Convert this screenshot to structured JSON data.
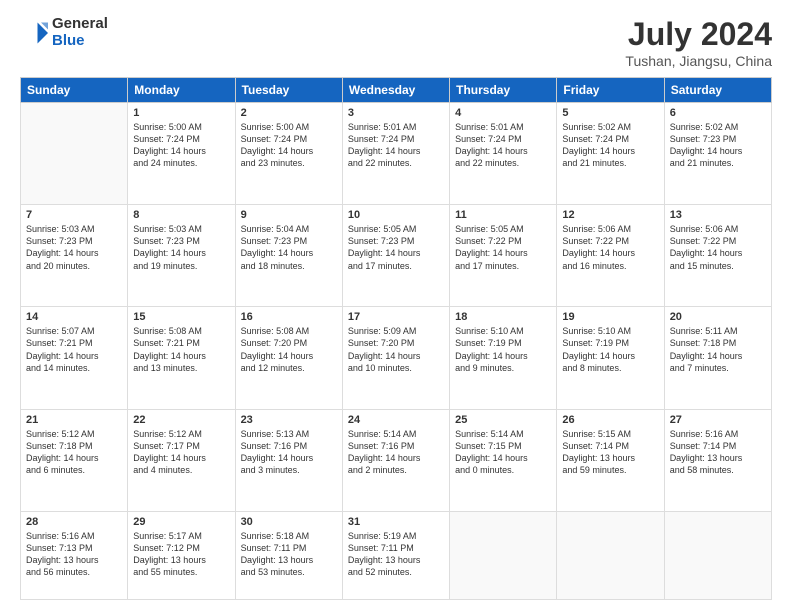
{
  "header": {
    "logo_general": "General",
    "logo_blue": "Blue",
    "month_year": "July 2024",
    "location": "Tushan, Jiangsu, China"
  },
  "days_of_week": [
    "Sunday",
    "Monday",
    "Tuesday",
    "Wednesday",
    "Thursday",
    "Friday",
    "Saturday"
  ],
  "weeks": [
    [
      {
        "day": "",
        "content": ""
      },
      {
        "day": "1",
        "content": "Sunrise: 5:00 AM\nSunset: 7:24 PM\nDaylight: 14 hours\nand 24 minutes."
      },
      {
        "day": "2",
        "content": "Sunrise: 5:00 AM\nSunset: 7:24 PM\nDaylight: 14 hours\nand 23 minutes."
      },
      {
        "day": "3",
        "content": "Sunrise: 5:01 AM\nSunset: 7:24 PM\nDaylight: 14 hours\nand 22 minutes."
      },
      {
        "day": "4",
        "content": "Sunrise: 5:01 AM\nSunset: 7:24 PM\nDaylight: 14 hours\nand 22 minutes."
      },
      {
        "day": "5",
        "content": "Sunrise: 5:02 AM\nSunset: 7:24 PM\nDaylight: 14 hours\nand 21 minutes."
      },
      {
        "day": "6",
        "content": "Sunrise: 5:02 AM\nSunset: 7:23 PM\nDaylight: 14 hours\nand 21 minutes."
      }
    ],
    [
      {
        "day": "7",
        "content": "Sunrise: 5:03 AM\nSunset: 7:23 PM\nDaylight: 14 hours\nand 20 minutes."
      },
      {
        "day": "8",
        "content": "Sunrise: 5:03 AM\nSunset: 7:23 PM\nDaylight: 14 hours\nand 19 minutes."
      },
      {
        "day": "9",
        "content": "Sunrise: 5:04 AM\nSunset: 7:23 PM\nDaylight: 14 hours\nand 18 minutes."
      },
      {
        "day": "10",
        "content": "Sunrise: 5:05 AM\nSunset: 7:23 PM\nDaylight: 14 hours\nand 17 minutes."
      },
      {
        "day": "11",
        "content": "Sunrise: 5:05 AM\nSunset: 7:22 PM\nDaylight: 14 hours\nand 17 minutes."
      },
      {
        "day": "12",
        "content": "Sunrise: 5:06 AM\nSunset: 7:22 PM\nDaylight: 14 hours\nand 16 minutes."
      },
      {
        "day": "13",
        "content": "Sunrise: 5:06 AM\nSunset: 7:22 PM\nDaylight: 14 hours\nand 15 minutes."
      }
    ],
    [
      {
        "day": "14",
        "content": "Sunrise: 5:07 AM\nSunset: 7:21 PM\nDaylight: 14 hours\nand 14 minutes."
      },
      {
        "day": "15",
        "content": "Sunrise: 5:08 AM\nSunset: 7:21 PM\nDaylight: 14 hours\nand 13 minutes."
      },
      {
        "day": "16",
        "content": "Sunrise: 5:08 AM\nSunset: 7:20 PM\nDaylight: 14 hours\nand 12 minutes."
      },
      {
        "day": "17",
        "content": "Sunrise: 5:09 AM\nSunset: 7:20 PM\nDaylight: 14 hours\nand 10 minutes."
      },
      {
        "day": "18",
        "content": "Sunrise: 5:10 AM\nSunset: 7:19 PM\nDaylight: 14 hours\nand 9 minutes."
      },
      {
        "day": "19",
        "content": "Sunrise: 5:10 AM\nSunset: 7:19 PM\nDaylight: 14 hours\nand 8 minutes."
      },
      {
        "day": "20",
        "content": "Sunrise: 5:11 AM\nSunset: 7:18 PM\nDaylight: 14 hours\nand 7 minutes."
      }
    ],
    [
      {
        "day": "21",
        "content": "Sunrise: 5:12 AM\nSunset: 7:18 PM\nDaylight: 14 hours\nand 6 minutes."
      },
      {
        "day": "22",
        "content": "Sunrise: 5:12 AM\nSunset: 7:17 PM\nDaylight: 14 hours\nand 4 minutes."
      },
      {
        "day": "23",
        "content": "Sunrise: 5:13 AM\nSunset: 7:16 PM\nDaylight: 14 hours\nand 3 minutes."
      },
      {
        "day": "24",
        "content": "Sunrise: 5:14 AM\nSunset: 7:16 PM\nDaylight: 14 hours\nand 2 minutes."
      },
      {
        "day": "25",
        "content": "Sunrise: 5:14 AM\nSunset: 7:15 PM\nDaylight: 14 hours\nand 0 minutes."
      },
      {
        "day": "26",
        "content": "Sunrise: 5:15 AM\nSunset: 7:14 PM\nDaylight: 13 hours\nand 59 minutes."
      },
      {
        "day": "27",
        "content": "Sunrise: 5:16 AM\nSunset: 7:14 PM\nDaylight: 13 hours\nand 58 minutes."
      }
    ],
    [
      {
        "day": "28",
        "content": "Sunrise: 5:16 AM\nSunset: 7:13 PM\nDaylight: 13 hours\nand 56 minutes."
      },
      {
        "day": "29",
        "content": "Sunrise: 5:17 AM\nSunset: 7:12 PM\nDaylight: 13 hours\nand 55 minutes."
      },
      {
        "day": "30",
        "content": "Sunrise: 5:18 AM\nSunset: 7:11 PM\nDaylight: 13 hours\nand 53 minutes."
      },
      {
        "day": "31",
        "content": "Sunrise: 5:19 AM\nSunset: 7:11 PM\nDaylight: 13 hours\nand 52 minutes."
      },
      {
        "day": "",
        "content": ""
      },
      {
        "day": "",
        "content": ""
      },
      {
        "day": "",
        "content": ""
      }
    ]
  ]
}
